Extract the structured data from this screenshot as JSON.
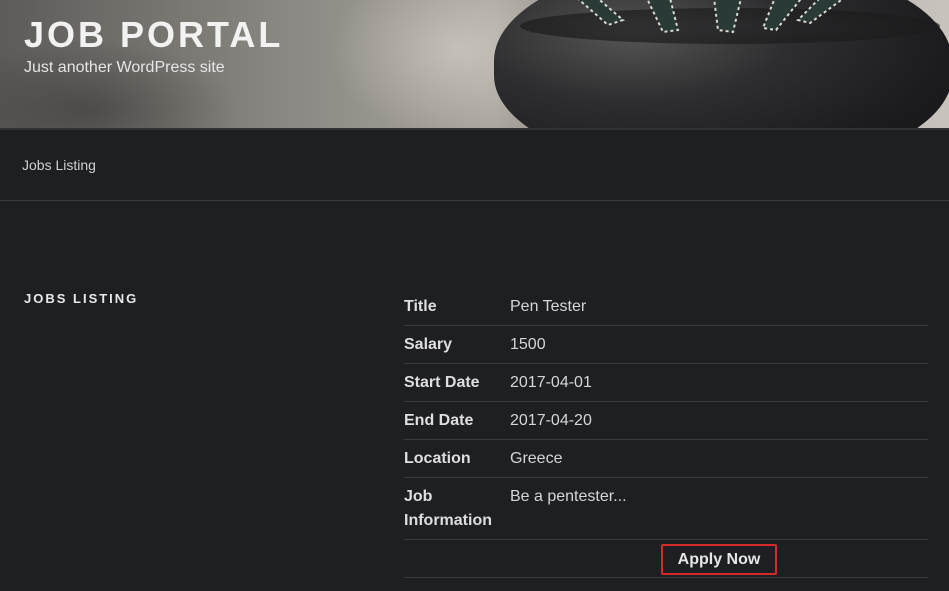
{
  "header": {
    "title": "JOB PORTAL",
    "description": "Just another WordPress site"
  },
  "nav": {
    "items": [
      {
        "label": "Jobs Listing"
      }
    ]
  },
  "main": {
    "section_title": "JOBS LISTING",
    "job": {
      "rows": [
        {
          "label": "Title",
          "value": "Pen Tester"
        },
        {
          "label": "Salary",
          "value": "1500"
        },
        {
          "label": "Start Date",
          "value": "2017-04-01"
        },
        {
          "label": "End Date",
          "value": "2017-04-20"
        },
        {
          "label": "Location",
          "value": "Greece"
        },
        {
          "label": "Job Information",
          "value": "Be a pentester..."
        }
      ],
      "apply_label": "Apply Now"
    }
  },
  "colors": {
    "background": "#1d1f22",
    "text": "#e6e6e6",
    "apply_border": "#d52a2a"
  }
}
